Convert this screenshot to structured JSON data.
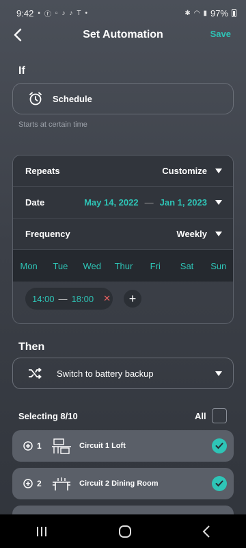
{
  "status_bar": {
    "time": "9:42",
    "battery": "97%"
  },
  "header": {
    "title": "Set Automation",
    "save_label": "Save"
  },
  "if_section": {
    "title": "If",
    "trigger_label": "Schedule",
    "trigger_icon": "alarm-clock-icon",
    "hint": "Starts at certain time"
  },
  "schedule": {
    "repeats_label": "Repeats",
    "repeats_value": "Customize",
    "date_label": "Date",
    "date_start": "May 14, 2022",
    "date_separator": "—",
    "date_end": "Jan 1, 2023",
    "frequency_label": "Frequency",
    "frequency_value": "Weekly",
    "days": [
      "Mon",
      "Tue",
      "Wed",
      "Thur",
      "Fri",
      "Sat",
      "Sun"
    ],
    "time_slot": {
      "start": "14:00",
      "separator": "—",
      "end": "18:00"
    }
  },
  "then_section": {
    "title": "Then",
    "action_label": "Switch to battery backup",
    "action_icon": "shuffle-icon"
  },
  "selection": {
    "label": "Selecting 8/10",
    "all_label": "All",
    "circuits": [
      {
        "num": "1",
        "name": "Circuit 1 Loft",
        "checked": true
      },
      {
        "num": "2",
        "name": "Circuit 2 Dining Room",
        "checked": true
      }
    ]
  },
  "colors": {
    "accent": "#2ec4b6",
    "remove": "#e86060",
    "background": "#3c4048"
  }
}
